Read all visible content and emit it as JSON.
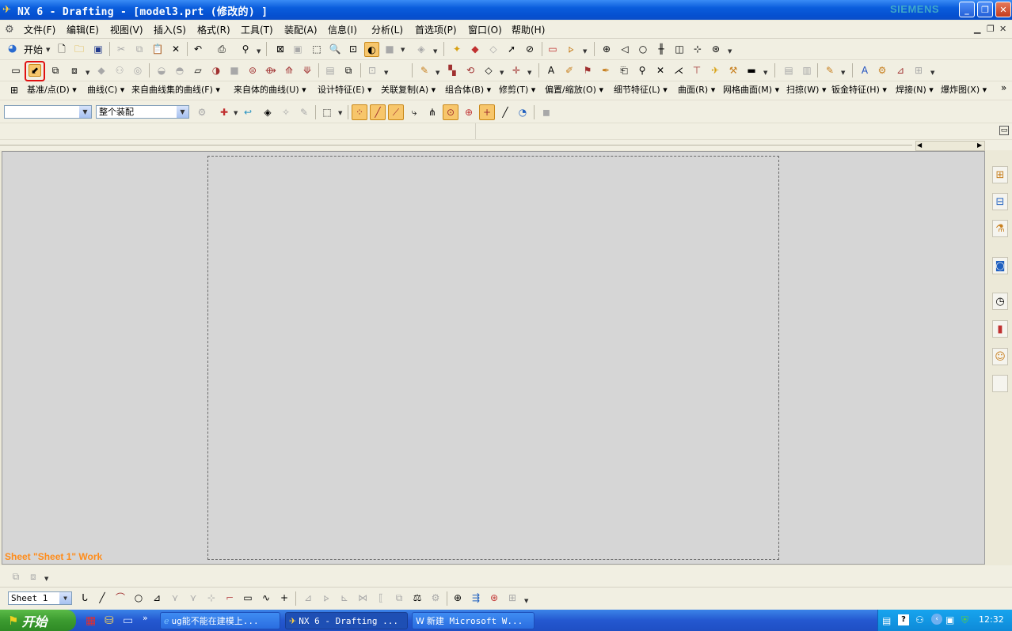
{
  "window": {
    "title": "NX 6 - Drafting - [model3.prt (修改的) ]",
    "brand": "SIEMENS",
    "min": "_",
    "max": "❐",
    "close": "✕"
  },
  "menubar": {
    "items": [
      "文件(F)",
      "编辑(E)",
      "视图(V)",
      "插入(S)",
      "格式(R)",
      "工具(T)",
      "装配(A)",
      "信息(I)",
      "分析(L)",
      "首选项(P)",
      "窗口(O)",
      "帮助(H)"
    ]
  },
  "standard_toolbar": {
    "start_label": "开始"
  },
  "curve_menus": {
    "items": [
      "基准/点(D)",
      "曲线(C)",
      "来自曲线集的曲线(F)",
      "来自体的曲线(U)",
      "设计特征(E)",
      "关联复制(A)",
      "组合体(B)",
      "修剪(T)",
      "偏置/缩放(O)",
      "细节特征(L)",
      "曲面(R)",
      "网格曲面(M)",
      "扫掠(W)",
      "钣金特征(H)",
      "焊接(N)",
      "爆炸图(X)"
    ]
  },
  "selection_bar": {
    "filter_value": "",
    "scope_value": "整个装配"
  },
  "drawing": {
    "status_text": "Sheet \"Sheet 1\" Work"
  },
  "sheet_bar": {
    "sheet_value": "Sheet 1"
  },
  "taskbar": {
    "start_label": "开始",
    "tasks": [
      "ug能不能在建模上...",
      "NX 6 - Drafting ...",
      "新建 Microsoft W..."
    ],
    "clock": "12:32"
  },
  "colors": {
    "titlebar": "#0a5ddc",
    "status_text": "#ff8c1a",
    "graphics_bg": "#d6d6d6",
    "taskbar": "#2458d0",
    "start_button": "#3c9b30"
  }
}
